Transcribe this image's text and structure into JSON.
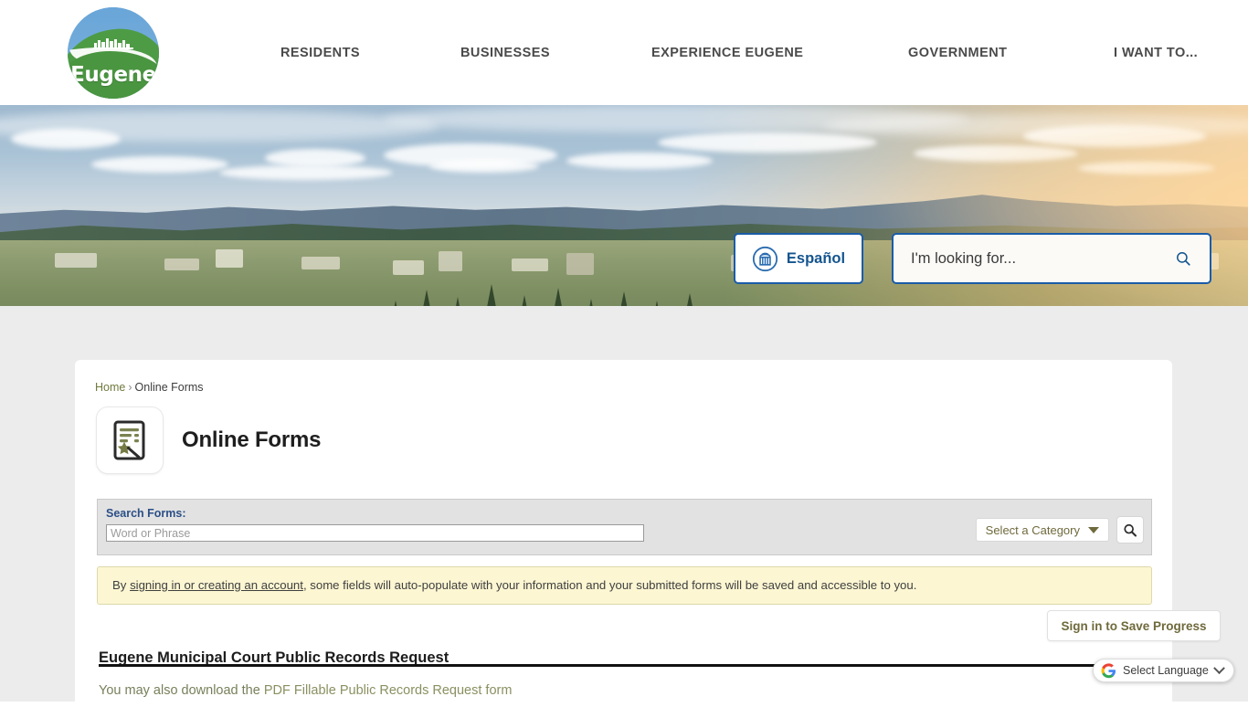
{
  "header": {
    "logo": {
      "word": "Eugene",
      "alt": "eugene-city-logo"
    },
    "nav": [
      {
        "label": "RESIDENTS"
      },
      {
        "label": "BUSINESSES"
      },
      {
        "label": "EXPERIENCE EUGENE"
      },
      {
        "label": "GOVERNMENT"
      },
      {
        "label": "I WANT TO..."
      }
    ]
  },
  "hero": {
    "espanol_label": "Español",
    "search_placeholder": "I'm looking for...",
    "search_value": ""
  },
  "breadcrumb": {
    "home": "Home",
    "separator": "›",
    "current": "Online Forms"
  },
  "page": {
    "title": "Online Forms"
  },
  "search_forms": {
    "label": "Search Forms:",
    "input_placeholder": "Word or Phrase",
    "input_value": "",
    "category_label": "Select a Category"
  },
  "notice": {
    "prefix": "By ",
    "link": "signing in or creating an account",
    "suffix": ", some fields will auto-populate with your information and your submitted forms will be saved and accessible to you."
  },
  "form": {
    "title": "Eugene Municipal Court Public Records Request",
    "save_button": "Sign in to Save Progress",
    "sub_prefix": "You may also download the ",
    "sub_link": "PDF Fillable Public Records Request form"
  },
  "translate": {
    "label": "Select Language"
  },
  "colors": {
    "brand_blue": "#1a5ca8",
    "label_blue": "#2c4f87",
    "olive": "#6f6a3c",
    "notice_bg": "#fcf6d2",
    "panel_gray": "#e2e2e2",
    "page_bg": "#ececec",
    "logo_green": "#4a9540",
    "logo_blue": "#5b9bd5"
  }
}
